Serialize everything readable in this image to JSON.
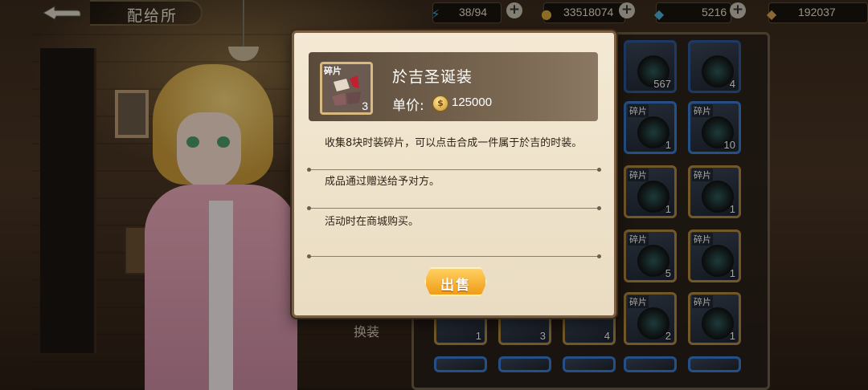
{
  "topbar": {
    "screen_title": "配给所",
    "resources": [
      {
        "name": "stamina",
        "icon": "lightning-icon",
        "value": "38/94",
        "color": "#3aa0e0"
      },
      {
        "name": "gold",
        "icon": "gold-coin-icon",
        "value": "33518074",
        "color": "#d8a83a"
      },
      {
        "name": "gems",
        "icon": "crystal-icon",
        "value": "5216",
        "color": "#4ab0d8"
      },
      {
        "name": "tickets",
        "icon": "ticket-icon",
        "value": "192037",
        "color": "#d8a050"
      }
    ],
    "plus_label": "+"
  },
  "inventory": {
    "slots": [
      {
        "tag": "",
        "count": "567"
      },
      {
        "tag": "",
        "count": "4"
      },
      {
        "tag": "碎片",
        "count": "1"
      },
      {
        "tag": "碎片",
        "count": "10"
      },
      {
        "tag": "碎片",
        "count": "1"
      },
      {
        "tag": "碎片",
        "count": "1"
      },
      {
        "tag": "碎片",
        "count": "5"
      },
      {
        "tag": "碎片",
        "count": "1"
      },
      {
        "tag": "碎片",
        "count": "2"
      },
      {
        "tag": "碎片",
        "count": "1"
      }
    ],
    "bottom_counts": [
      "1",
      "3",
      "4"
    ],
    "swap_label": "换装"
  },
  "modal": {
    "item_tag": "碎片",
    "item_count": "3",
    "item_name": "於吉圣诞装",
    "price_label": "单价:",
    "price_value": "125000",
    "coin_glyph": "$",
    "desc_1": "收集8块时装碎片，可以点击合成一件属于於吉的时装。",
    "desc_2": "成品通过赠送给予对方。",
    "desc_3": "活动时在商城购买。",
    "sell_label": "出售"
  },
  "colors": {
    "accent_gold": "#f0a020",
    "panel_bg": "#f4e9d4"
  }
}
